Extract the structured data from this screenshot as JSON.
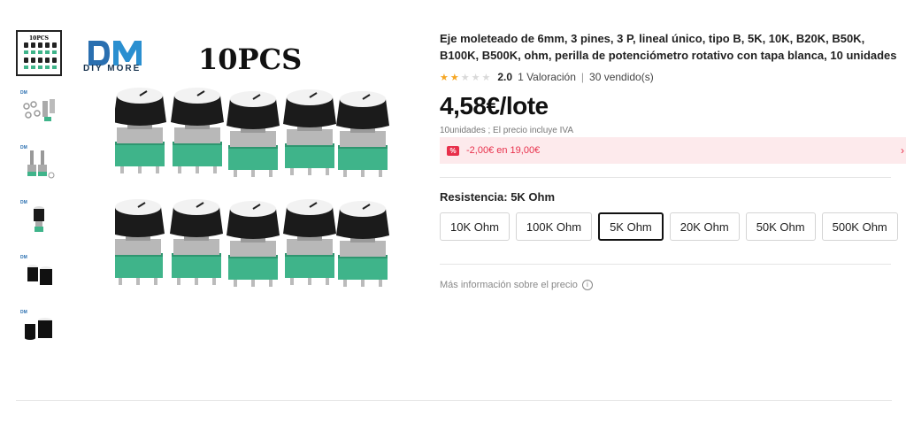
{
  "thumbnails": [
    {
      "name": "thumb-10pcs",
      "active": true
    },
    {
      "name": "thumb-parts"
    },
    {
      "name": "thumb-pots"
    },
    {
      "name": "thumb-single"
    },
    {
      "name": "thumb-knobs"
    },
    {
      "name": "thumb-knob-caps"
    }
  ],
  "main_image": {
    "brand": "DIY MORE",
    "pcs_label": "10PCS"
  },
  "product": {
    "title": "Eje moleteado de 6mm, 3 pines, 3 P, lineal único, tipo B, 5K, 10K, B20K, B50K, B100K, B500K, ohm, perilla de potenciómetro rotativo con tapa blanca, 10 unidades",
    "rating_score": "2.0",
    "rating_stars": 2,
    "rating_count": "1 Valoración",
    "sold": "30 vendido(s)",
    "price": "4,58€/lote",
    "tax_note": "10unidades ; El precio incluye IVA",
    "promo": "-2,00€ en 19,00€",
    "variant_label": "Resistencia: 5K Ohm",
    "options": [
      "10K Ohm",
      "100K Ohm",
      "5K Ohm",
      "20K Ohm",
      "50K Ohm",
      "500K Ohm"
    ],
    "selected_option": "5K Ohm",
    "more_info": "Más información sobre el precio"
  },
  "colors": {
    "accent_red": "#e8304b",
    "promo_bg": "#fdeaec",
    "star": "#f5a623",
    "pot_green": "#3fb48a"
  }
}
